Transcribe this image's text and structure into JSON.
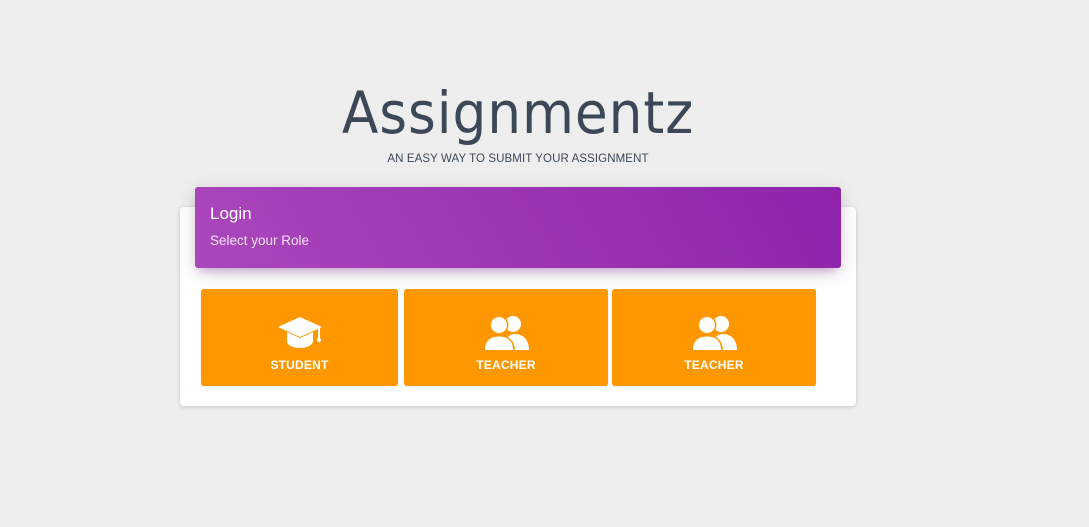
{
  "brand": {
    "title": "Assignmentz",
    "subtitle": "AN EASY WAY TO SUBMIT YOUR ASSIGNMENT"
  },
  "login_card": {
    "title": "Login",
    "category": "Select your Role",
    "header_colors": [
      "#ab47bc",
      "#8e24aa"
    ],
    "roles": [
      {
        "label": "STUDENT",
        "icon": "graduation-cap-icon",
        "color": "#ff9800"
      },
      {
        "label": "TEACHER",
        "icon": "users-icon",
        "color": "#ff9800"
      },
      {
        "label": "TEACHER",
        "icon": "users-icon",
        "color": "#ff9800"
      }
    ]
  },
  "colors": {
    "background": "#eeeeee",
    "text_dark": "#3c4858",
    "accent_orange": "#ff9800"
  }
}
